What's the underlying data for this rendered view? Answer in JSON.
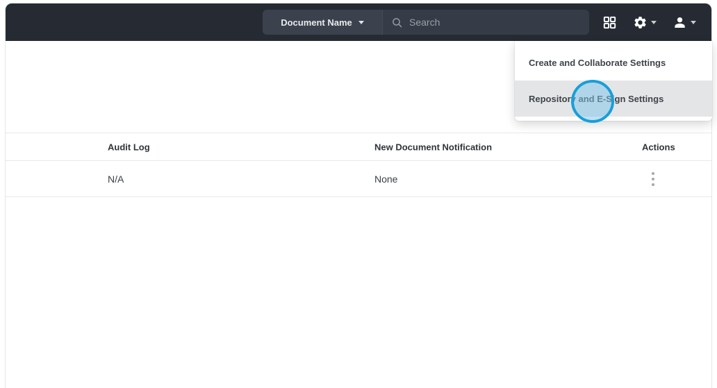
{
  "topbar": {
    "document_selector": {
      "label": "Document Name",
      "icon": "chevron-down-icon"
    },
    "search": {
      "placeholder": "Search",
      "icon": "magnifier-icon",
      "value": ""
    },
    "apps_icon": "apps-grid-icon",
    "settings_icon": "gear-icon",
    "account_icon": "person-icon"
  },
  "settings_menu": {
    "items": [
      {
        "label": "Create and Collaborate Settings",
        "highlighted": false
      },
      {
        "label": "Repository and E-Sign Settings",
        "highlighted": true
      }
    ]
  },
  "click_annotation": {
    "target": "Repository and E-Sign Settings",
    "ring_color": "#189fd9",
    "fill_color": "rgba(125,198,233,0.5)"
  },
  "table": {
    "headers": [
      "Audit Log",
      "New Document Notification",
      "Actions"
    ],
    "rows": [
      {
        "audit_log": "N/A",
        "new_document_notification": "None",
        "actions_icon": "kebab-menu-icon"
      }
    ]
  },
  "colors": {
    "topbar_bg": "#262b33",
    "search_pill_bg": "#3b424d",
    "search_field_bg": "#353c47",
    "menu_highlight_bg": "#e4e5e7",
    "table_border": "#e5e8eb"
  }
}
